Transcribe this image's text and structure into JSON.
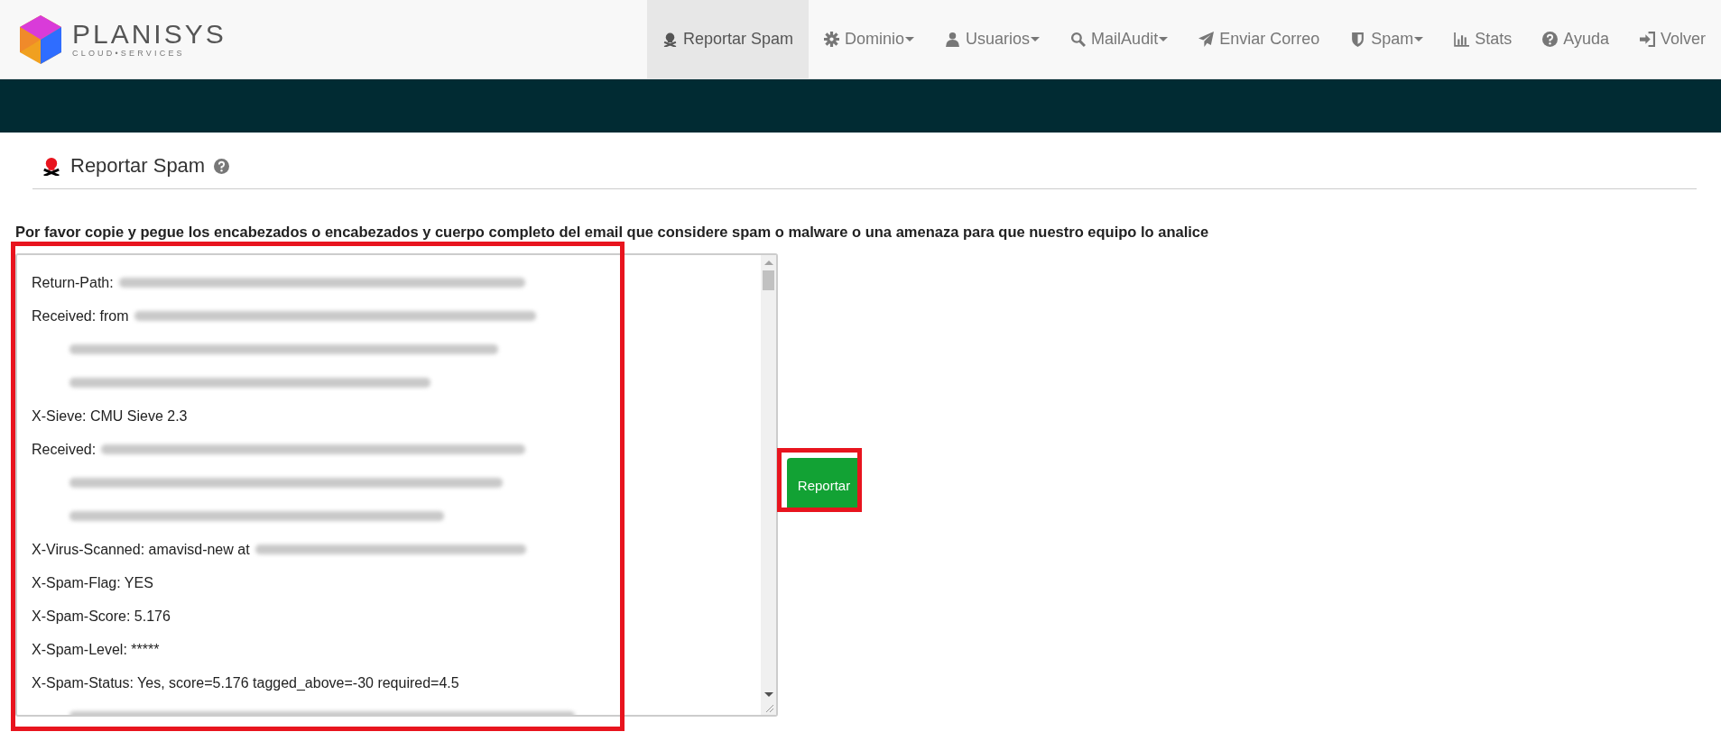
{
  "brand": {
    "name": "PLANISYS",
    "tagline": "CLOUD•SERVICES"
  },
  "nav": [
    {
      "label": "Reportar Spam",
      "dropdown": false,
      "selected": true
    },
    {
      "label": "Dominio",
      "dropdown": true,
      "selected": false
    },
    {
      "label": "Usuarios",
      "dropdown": true,
      "selected": false
    },
    {
      "label": "MailAudit",
      "dropdown": true,
      "selected": false
    },
    {
      "label": "Enviar Correo",
      "dropdown": false,
      "selected": false
    },
    {
      "label": "Spam",
      "dropdown": true,
      "selected": false
    },
    {
      "label": "Stats",
      "dropdown": false,
      "selected": false
    },
    {
      "label": "Ayuda",
      "dropdown": false,
      "selected": false
    },
    {
      "label": "Volver",
      "dropdown": false,
      "selected": false
    }
  ],
  "page_title": "Reportar Spam",
  "instructions": "Por favor copie y pegue los encabezados o encabezados y cuerpo completo del email que considere spam o malware o una amenaza para que nuestro equipo lo analice",
  "message_lines": [
    {
      "kind": "header",
      "segments": [
        {
          "kind": "text",
          "text": "Return-Path:"
        },
        {
          "kind": "blurred"
        }
      ]
    },
    {
      "kind": "header",
      "segments": [
        {
          "kind": "text",
          "text": "Received: from"
        },
        {
          "kind": "blurred"
        }
      ]
    },
    {
      "kind": "continuation",
      "segments": [
        {
          "kind": "blurred"
        }
      ]
    },
    {
      "kind": "continuation",
      "segments": [
        {
          "kind": "blurred"
        }
      ]
    },
    {
      "kind": "header",
      "segments": [
        {
          "kind": "text",
          "text": "X-Sieve: CMU Sieve 2.3"
        }
      ]
    },
    {
      "kind": "header",
      "segments": [
        {
          "kind": "text",
          "text": "Received:"
        },
        {
          "kind": "blurred"
        }
      ]
    },
    {
      "kind": "continuation",
      "segments": [
        {
          "kind": "blurred"
        }
      ]
    },
    {
      "kind": "continuation",
      "segments": [
        {
          "kind": "blurred"
        }
      ]
    },
    {
      "kind": "header",
      "segments": [
        {
          "kind": "text",
          "text": "X-Virus-Scanned: amavisd-new at"
        },
        {
          "kind": "blurred"
        }
      ]
    },
    {
      "kind": "header",
      "segments": [
        {
          "kind": "text",
          "text": "X-Spam-Flag: YES"
        }
      ]
    },
    {
      "kind": "header",
      "segments": [
        {
          "kind": "text",
          "text": "X-Spam-Score: 5.176"
        }
      ]
    },
    {
      "kind": "header",
      "segments": [
        {
          "kind": "text",
          "text": "X-Spam-Level: *****"
        }
      ]
    },
    {
      "kind": "header",
      "segments": [
        {
          "kind": "text",
          "text": "X-Spam-Status: Yes, score=5.176 tagged_above=-30 required=4.5"
        }
      ]
    },
    {
      "kind": "continuation",
      "segments": [
        {
          "kind": "blurred"
        }
      ]
    }
  ],
  "submit_button": "Reportar"
}
